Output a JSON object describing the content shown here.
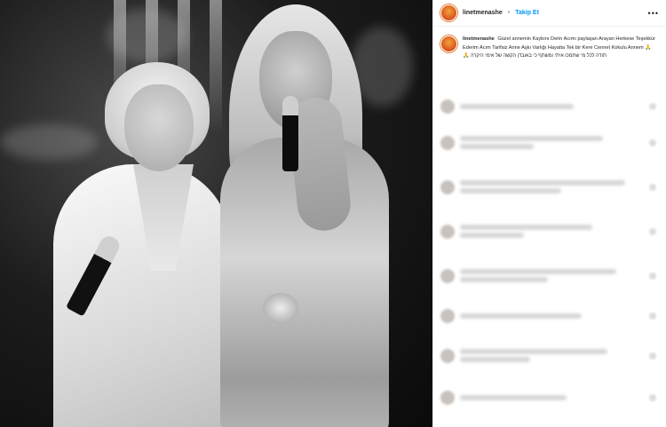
{
  "post": {
    "username": "linetmenashe",
    "separator": "•",
    "follow_label": "Takip Et",
    "more_label": "•••"
  },
  "caption": {
    "username": "linetmenashe",
    "text_tr": "Güzel annemin Kaybını Derin Acımı paylaşan Arayan Herkese Teşekkür Ederim Acım Tarifsiz Anne Aşkı Varlığı Hayatta Tek bir Kere Cennet Kokulu Annem",
    "text_he": "תודה לכל מי שתמכו איתי ומשתף כי באובדן הקשה של אימי היקרה",
    "emoji": "🙏"
  },
  "icons": {
    "avatar": "profile-avatar-icon",
    "more": "more-options-icon",
    "heart": "heart-icon"
  },
  "colors": {
    "follow": "#0095f6",
    "avatar_ring": "#e0792a"
  }
}
